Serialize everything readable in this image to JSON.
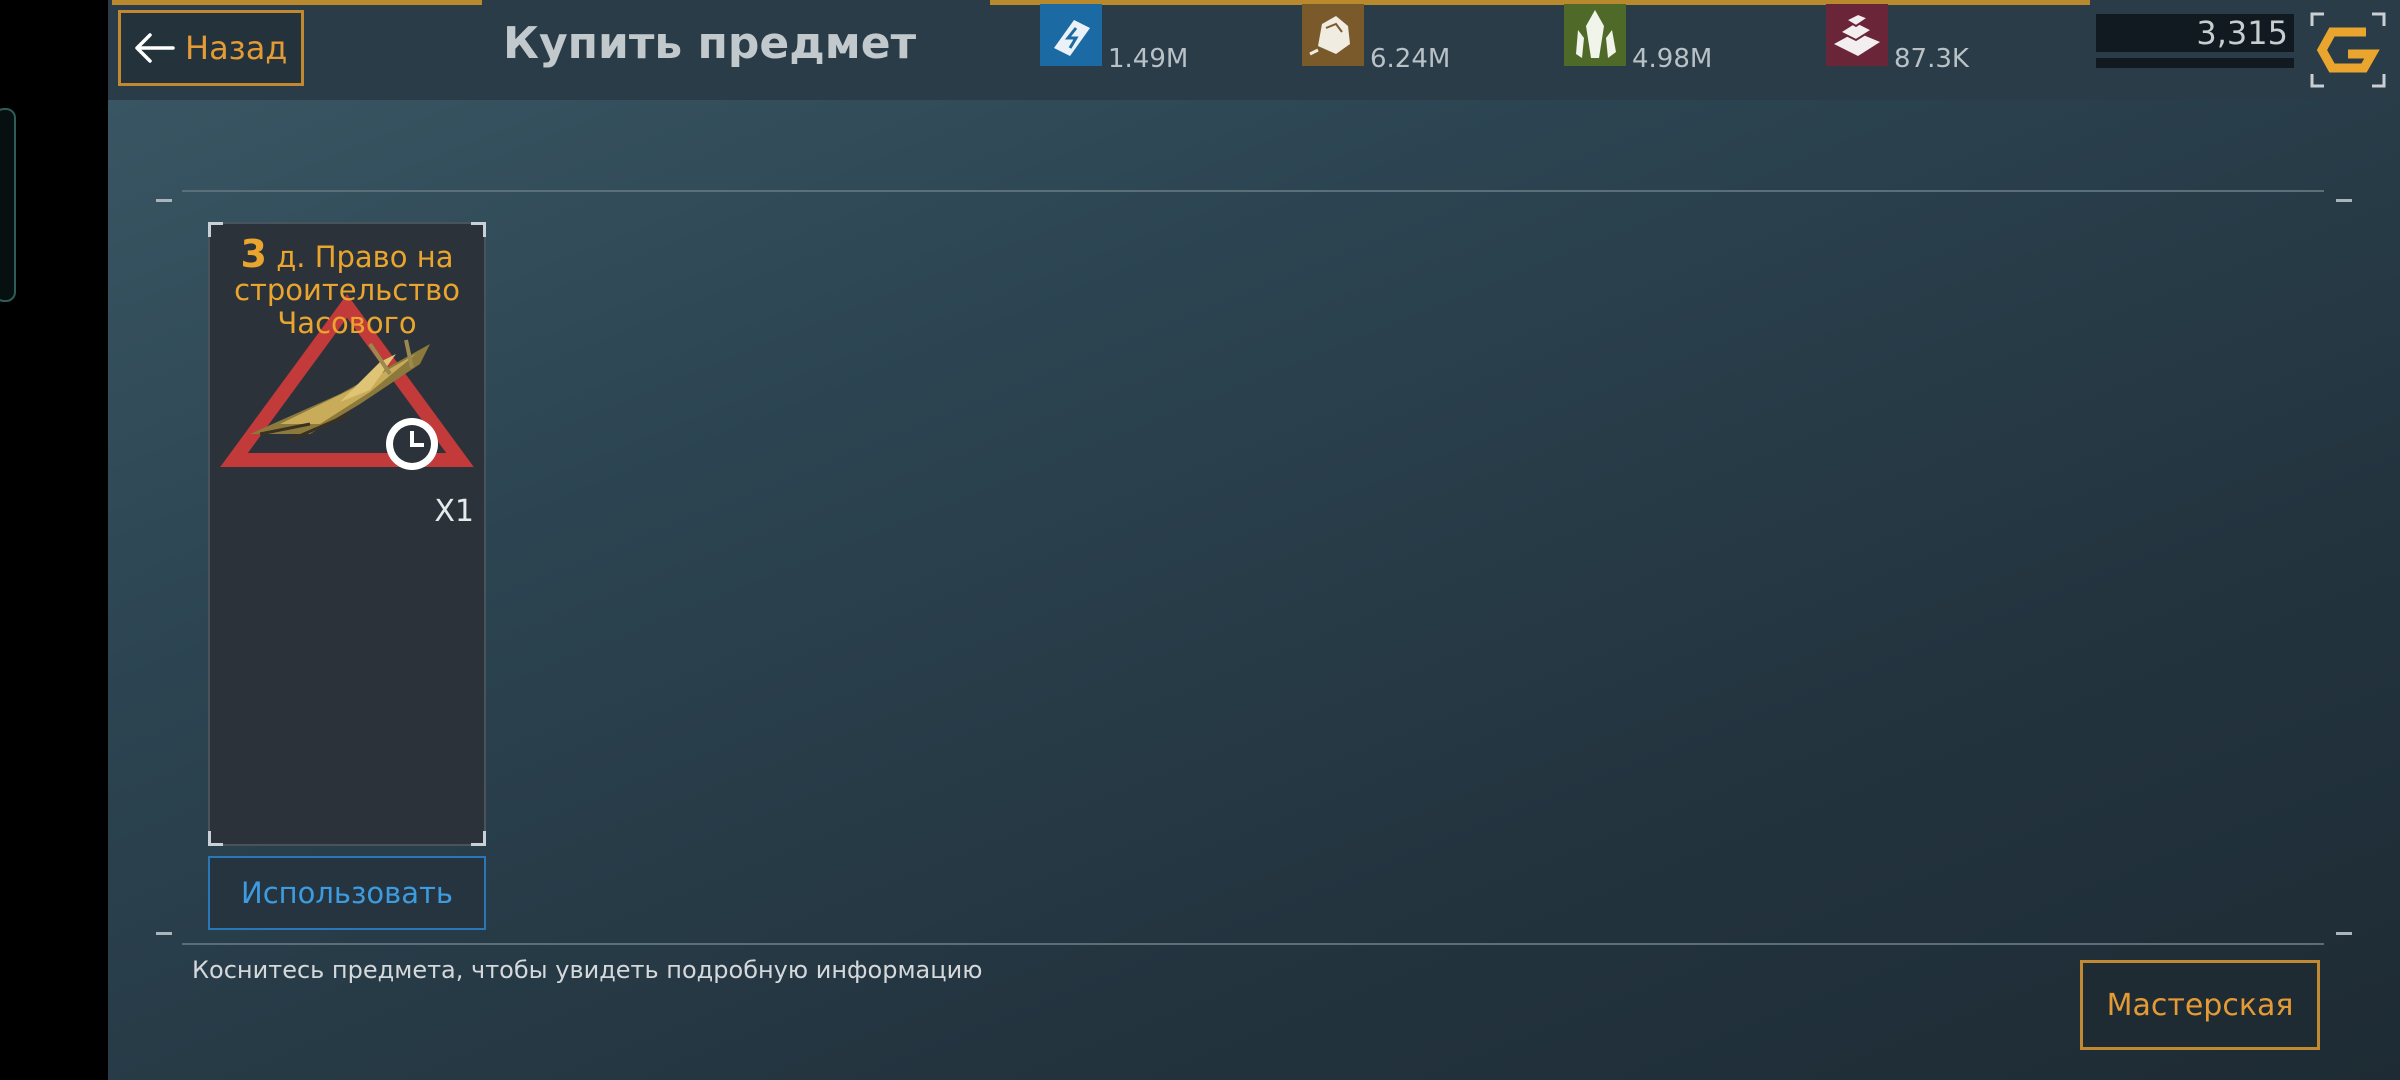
{
  "header": {
    "back_label": "Назад",
    "title": "Купить предмет"
  },
  "resources": [
    {
      "name": "energy-resource",
      "icon": "energy-cell-icon",
      "value": "1.49M",
      "color": "#1c6aa3"
    },
    {
      "name": "ore-resource",
      "icon": "ore-rock-icon",
      "value": "6.24M",
      "color": "#7a5a2a"
    },
    {
      "name": "crystal-resource",
      "icon": "crystal-icon",
      "value": "4.98M",
      "color": "#4f6a28"
    },
    {
      "name": "alloy-resource",
      "icon": "alloy-bars-icon",
      "value": "87.3K",
      "color": "#6a2638"
    }
  ],
  "balance": {
    "value": "3,315",
    "icon": "galaxy-coin-logo-icon",
    "color": "#e9a52d"
  },
  "item": {
    "title_number": "3",
    "title_rest": " д. Право на строительство Часового",
    "quantity": "X1",
    "icon": "spaceship-blueprint-icon",
    "badge_icon": "clock-icon"
  },
  "use_button": "Использовать",
  "hint": "Коснитесь предмета, чтобы увидеть подробную информацию",
  "workshop_button": "Мастерская",
  "colors": {
    "accent": "#e49a35",
    "use_blue": "#3d9be0",
    "title_gold": "#e9a52d"
  }
}
